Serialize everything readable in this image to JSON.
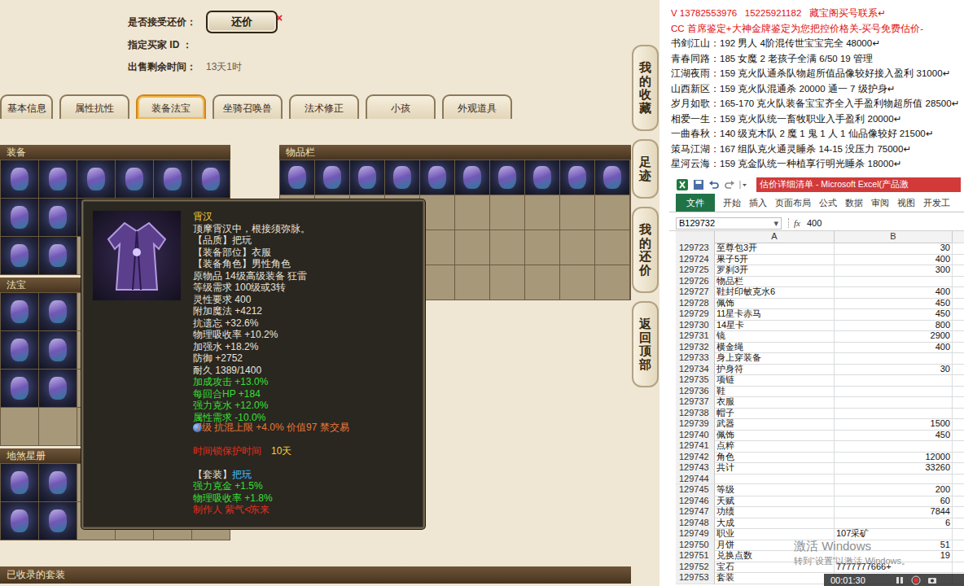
{
  "sale_info": {
    "counter_offer_label": "是否接受还价：",
    "counter_offer_button": "还价",
    "close_mark": "×",
    "buyer_label": "指定买家 ID ：",
    "time_label": "出售剩余时间：",
    "time_value": "13天1时"
  },
  "tabs": [
    {
      "label": "基本信息",
      "selected": false
    },
    {
      "label": "属性抗性",
      "selected": false
    },
    {
      "label": "装备法宝",
      "selected": true
    },
    {
      "label": "坐骑召唤兽",
      "selected": false
    },
    {
      "label": "法术修正",
      "selected": false
    },
    {
      "label": "小孩",
      "selected": false
    },
    {
      "label": "外观道具",
      "selected": false
    }
  ],
  "side_buttons": [
    "我的收藏",
    "足迹",
    "我的还价",
    "返回顶部"
  ],
  "panels": [
    {
      "title": "装备",
      "slots": [
        {
          "filled": true
        },
        {
          "filled": true
        },
        {
          "filled": true
        },
        {
          "filled": true
        },
        {
          "filled": true
        },
        {
          "filled": true
        },
        {
          "filled": true
        },
        {
          "filled": true
        },
        {
          "filled": true
        },
        {
          "filled": false
        },
        {
          "filled": false
        },
        {
          "filled": false
        },
        {
          "filled": true
        },
        {
          "filled": true
        },
        {
          "filled": false
        },
        {
          "filled": false
        },
        {
          "filled": false
        },
        {
          "filled": false
        }
      ]
    },
    {
      "title": "法宝",
      "slots": [
        {
          "filled": true
        },
        {
          "filled": true
        },
        {
          "filled": false
        },
        {
          "filled": false
        },
        {
          "filled": false
        },
        {
          "filled": false
        },
        {
          "filled": true
        },
        {
          "filled": true
        },
        {
          "filled": false
        },
        {
          "filled": false
        },
        {
          "filled": false
        },
        {
          "filled": false
        },
        {
          "filled": true
        },
        {
          "filled": true
        },
        {
          "filled": false
        },
        {
          "filled": false
        },
        {
          "filled": false
        },
        {
          "filled": false
        },
        {
          "filled": false
        },
        {
          "filled": false
        },
        {
          "filled": false
        },
        {
          "filled": false
        },
        {
          "filled": false
        },
        {
          "filled": false
        }
      ]
    },
    {
      "title": "地煞星册",
      "slots": [
        {
          "filled": true
        },
        {
          "filled": true
        },
        {
          "filled": false
        },
        {
          "filled": false
        },
        {
          "filled": false
        },
        {
          "filled": false
        },
        {
          "filled": true
        },
        {
          "filled": true
        },
        {
          "filled": false
        },
        {
          "filled": false
        },
        {
          "filled": false
        },
        {
          "filled": false
        }
      ]
    }
  ],
  "inventory": {
    "title": "物品栏",
    "slots": [
      {
        "filled": true
      },
      {
        "filled": true
      },
      {
        "filled": true
      },
      {
        "filled": true
      },
      {
        "filled": true
      },
      {
        "filled": true
      },
      {
        "filled": true
      },
      {
        "filled": true
      },
      {
        "filled": true
      },
      {
        "filled": true
      },
      {
        "filled": false
      },
      {
        "filled": false
      },
      {
        "filled": false
      },
      {
        "filled": false
      },
      {
        "filled": false
      },
      {
        "filled": false
      },
      {
        "filled": false
      },
      {
        "filled": false
      },
      {
        "filled": false
      },
      {
        "filled": false
      },
      {
        "filled": false
      },
      {
        "filled": false
      },
      {
        "filled": false
      },
      {
        "filled": false
      },
      {
        "filled": false
      },
      {
        "filled": false
      },
      {
        "filled": false
      },
      {
        "filled": false
      },
      {
        "filled": false
      },
      {
        "filled": false
      },
      {
        "filled": false
      },
      {
        "filled": false
      },
      {
        "filled": false
      },
      {
        "filled": false
      },
      {
        "filled": false
      },
      {
        "filled": false
      },
      {
        "filled": false
      },
      {
        "filled": false
      },
      {
        "filled": false
      },
      {
        "filled": false
      }
    ]
  },
  "collected_title": "已收录的套装",
  "tooltip": {
    "title": "霄汉",
    "lines": [
      {
        "text": "顶摩霄汉中，根接须弥脉。",
        "kind": "text"
      },
      {
        "text": "【品质】把玩",
        "kind": "text"
      },
      {
        "text": "【装备部位】衣服",
        "kind": "text"
      },
      {
        "text": "【装备角色】男性角色",
        "kind": "text"
      },
      {
        "text": "原物品 14级高级装备 狂雷",
        "kind": "text"
      },
      {
        "text": "等级需求 100级或3转",
        "kind": "text"
      },
      {
        "text": "灵性要求 400",
        "kind": "text"
      },
      {
        "text": "附加魔法 +4212",
        "kind": "text"
      },
      {
        "text": "抗遗忘 +32.6%",
        "kind": "text"
      },
      {
        "text": "物理吸收率 +10.2%",
        "kind": "text"
      },
      {
        "text": "加强水 +18.2%",
        "kind": "text"
      },
      {
        "text": "防御 +2752",
        "kind": "text"
      },
      {
        "text": "耐久 1389/1400",
        "kind": "text"
      },
      {
        "text": "加成攻击 +13.0%",
        "kind": "bonus"
      },
      {
        "text": "每回合HP +184",
        "kind": "bonus"
      },
      {
        "text": "强力克水 +12.0%",
        "kind": "bonus"
      },
      {
        "text": "属性需求 -10.0%",
        "kind": "bonus"
      },
      {
        "text": "7级 抗混上限 +4.0% 价值97 禁交易",
        "kind": "gem"
      }
    ],
    "lock": {
      "label": "时间锁保护时间",
      "value": "10天"
    },
    "set": {
      "label": "【套装】",
      "name": "把玩"
    },
    "set_lines": [
      "强力克金 +1.5%",
      "物理吸收率 +1.8%"
    ],
    "maker": "制作人 紫气≮东来"
  },
  "listings": [
    {
      "kind": "contact",
      "text": "V 13782553976   15225921182   藏宝阁买号联系↵"
    },
    {
      "kind": "contact",
      "text": "CC 首席鉴定+大神金牌鉴定为您把控价格关-买号免费估价-"
    },
    {
      "kind": "listing",
      "text": "书剑江山：192 男人 4阶混传世宝宝完全 48000↵"
    },
    {
      "kind": "listing",
      "text": "青春同路：185 女魔 2 老孩子全满 6/50 19 管理"
    },
    {
      "kind": "listing",
      "text": "江湖夜雨：159 克火队通杀队物超所值品像较好接入盈利 31000↵"
    },
    {
      "kind": "listing",
      "text": "山西新区：159 克火队混通杀 20000 通一 7 级护身↵"
    },
    {
      "kind": "listing",
      "text": "岁月如歌：165-170 克火队装备宝宝齐全入手盈利物超所值 28500↵"
    },
    {
      "kind": "listing",
      "text": "相爱一生：159 克火队统一畜牧职业入手盈利 20000↵"
    },
    {
      "kind": "listing",
      "text": "一曲春秋：140 级克木队 2 魔 1 鬼 1 人 1 仙品像较好 21500↵"
    },
    {
      "kind": "listing",
      "text": "策马江湖：167 组队克火通灵睡杀 14-15 没压力 75000↵"
    },
    {
      "kind": "listing",
      "text": "星河云海：159 克金队统一种植享行明光睡杀 18000↵"
    }
  ],
  "excel": {
    "title": "估价详细清单 - Microsoft Excel(产品激",
    "file_tab": "文件",
    "tabs": [
      "开始",
      "插入",
      "页面布局",
      "公式",
      "数据",
      "审阅",
      "视图",
      "开发工"
    ],
    "name_box": "B129732",
    "name_box_arrow": "▾",
    "fx": "fx",
    "formula": "400",
    "columns": [
      "A",
      "B"
    ],
    "rows": [
      {
        "n": "129723",
        "a": "至尊包3开",
        "b": "30"
      },
      {
        "n": "129724",
        "a": "果子5开",
        "b": "400"
      },
      {
        "n": "129725",
        "a": "罗刹3开",
        "b": "300"
      },
      {
        "n": "129726",
        "a": "物品栏",
        "b": ""
      },
      {
        "n": "129727",
        "a": "鞋封印敏克水6",
        "b": "400"
      },
      {
        "n": "129728",
        "a": "佩饰",
        "b": "450"
      },
      {
        "n": "129729",
        "a": "11星卡赤马",
        "b": "450"
      },
      {
        "n": "129730",
        "a": "14星卡",
        "b": "800"
      },
      {
        "n": "129731",
        "a": "镜",
        "b": "2900"
      },
      {
        "n": "129732",
        "a": "横金绳",
        "b": "400"
      },
      {
        "n": "129733",
        "a": "身上穿装备",
        "b": ""
      },
      {
        "n": "129734",
        "a": "护身符",
        "b": "30"
      },
      {
        "n": "129735",
        "a": "项链",
        "b": ""
      },
      {
        "n": "129736",
        "a": "鞋",
        "b": ""
      },
      {
        "n": "129737",
        "a": "衣服",
        "b": ""
      },
      {
        "n": "129738",
        "a": "帽子",
        "b": ""
      },
      {
        "n": "129739",
        "a": "武器",
        "b": "1500"
      },
      {
        "n": "129740",
        "a": "佩饰",
        "b": "450"
      },
      {
        "n": "129741",
        "a": "点粹",
        "b": ""
      },
      {
        "n": "129742",
        "a": "角色",
        "b": "12000"
      },
      {
        "n": "129743",
        "a": "共计",
        "b": "33260"
      },
      {
        "n": "129744",
        "a": "",
        "b": ""
      },
      {
        "n": "129745",
        "a": "等级",
        "b": "200"
      },
      {
        "n": "129746",
        "a": "天赋",
        "b": "60"
      },
      {
        "n": "129747",
        "a": "功绩",
        "b": "7844"
      },
      {
        "n": "129748",
        "a": "大成",
        "b": "6"
      },
      {
        "n": "129749",
        "a": "职业",
        "b": "107采矿"
      },
      {
        "n": "129750",
        "a": "月饼",
        "b": "51"
      },
      {
        "n": "129751",
        "a": "兑换点数",
        "b": "19"
      },
      {
        "n": "129752",
        "a": "宝石",
        "b": "7777777666+"
      },
      {
        "n": "129753",
        "a": "套装",
        "b": ""
      }
    ]
  },
  "watermark": {
    "title": "激活 Windows",
    "subtitle": "转到“设置”以激活 Windows。"
  },
  "recorder": {
    "time": "00:01:30"
  }
}
